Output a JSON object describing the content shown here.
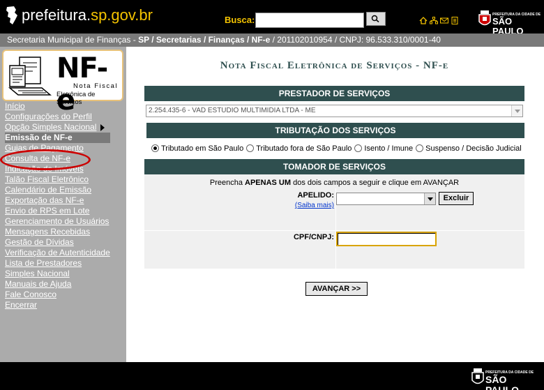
{
  "header": {
    "logo_main": "prefeitura.",
    "logo_accent": "sp.gov.br",
    "search_label": "Busca:",
    "search_value": "",
    "city_logo_small": "PREFEITURA DA CIDADE DE",
    "city_logo_big": "SÃO PAULO"
  },
  "breadcrumb": {
    "prefix": "Secretaria Municipal de Finanças - ",
    "bold_path": "SP / Secretarias / Finanças / NF-e",
    "suffix": " / 201102010954 / CNPJ: 96.533.310/0001-40"
  },
  "sidebar": {
    "nfe_logo_title": "NF-e",
    "nfe_logo_sub1": "Nota Fiscal",
    "nfe_logo_sub2": "Eletrônica de Serviços",
    "menu": [
      "Início",
      "Configurações do Perfil",
      "Opção Simples Nacional",
      "Emissão de NF-e",
      "Guias de Pagamento",
      "Consulta de NF-e",
      "Indicação de Imóveis",
      "Talão Fiscal Eletrônico",
      "Calendário de Emissão",
      "Exportação das NF-e",
      "Envio de RPS em Lote",
      "Gerenciamento de Usuários",
      "Mensagens Recebidas",
      "Gestão de Dívidas",
      "Verificação de Autenticidade",
      "Lista de Prestadores",
      "Simples Nacional",
      "Manuais de Ajuda",
      "Fale Conosco",
      "Encerrar"
    ]
  },
  "main": {
    "title": "Nota Fiscal Eletrônica de Serviços - NF-e",
    "prestador_header": "PRESTADOR DE SERVIÇOS",
    "prestador_selected": "2.254.435-6 - VAD ESTUDIO MULTIMIDIA LTDA - ME",
    "tributacao_header": "TRIBUTAÇÃO DOS SERVIÇOS",
    "tributacao_options": [
      "Tributado em São Paulo",
      "Tributado fora de São Paulo",
      "Isento / Imune",
      "Suspenso / Decisão Judicial"
    ],
    "tributacao_selected_index": 0,
    "tomador_header": "TOMADOR DE SERVIÇOS",
    "tomador_msg_pre": "Preencha ",
    "tomador_msg_bold": "APENAS UM",
    "tomador_msg_post": " dos dois campos a seguir e clique em AVANÇAR",
    "apelido_label": "APELIDO:",
    "saiba_mais": "(Saiba mais)",
    "apelido_value": "",
    "excluir_label": "Excluir",
    "cpf_label": "CPF/CNPJ:",
    "cpf_value": "",
    "avancar_label": "AVANÇAR >>"
  },
  "footer": {
    "logo_small": "PREFEITURA DA CIDADE DE",
    "logo_big": "SÃO PAULO"
  },
  "colors": {
    "section_header": "#2f4f4f",
    "sidebar_bg": "#ababab",
    "accent_yellow": "#f5c400",
    "highlight_red": "#cc0000"
  }
}
